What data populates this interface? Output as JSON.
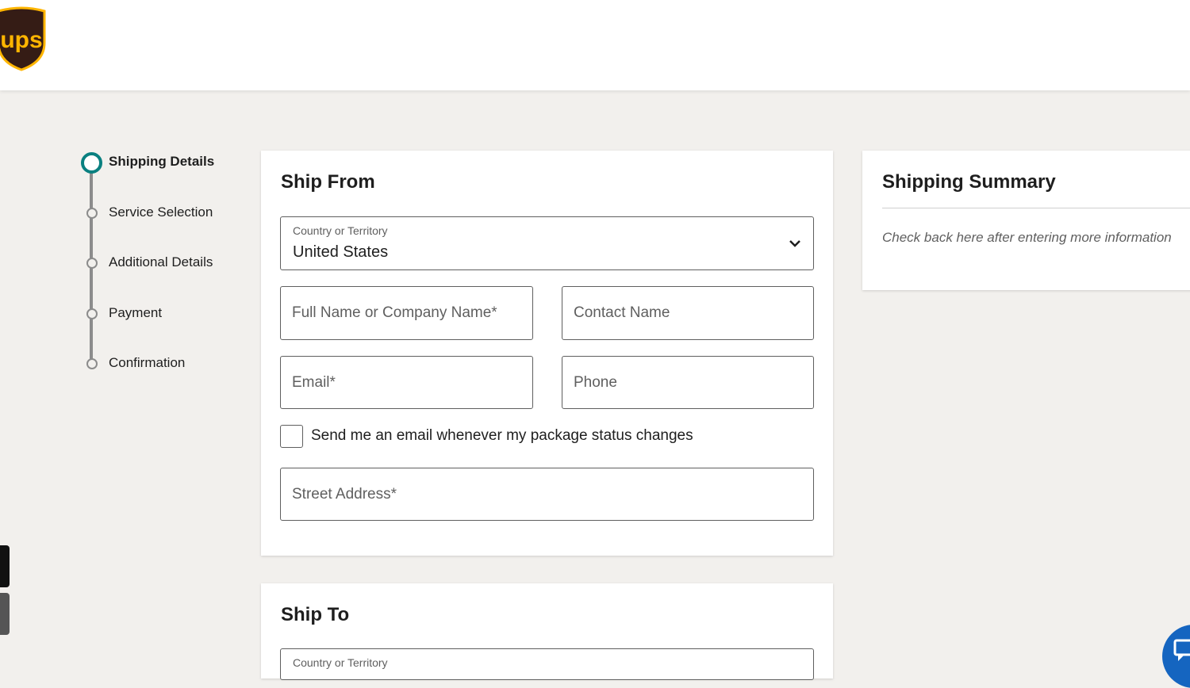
{
  "header": {
    "logo_text": "ups",
    "brand_colors": {
      "shield": "#351c15",
      "gold": "#ffb500"
    }
  },
  "stepper": {
    "accent_color": "#0a8080",
    "steps": [
      {
        "label": "Shipping Details",
        "active": true
      },
      {
        "label": "Service Selection",
        "active": false
      },
      {
        "label": "Additional Details",
        "active": false
      },
      {
        "label": "Payment",
        "active": false
      },
      {
        "label": "Confirmation",
        "active": false
      }
    ]
  },
  "ship_from": {
    "title": "Ship From",
    "country": {
      "label": "Country or Territory",
      "value": "United States",
      "icon": "chevron-down-icon"
    },
    "full_name": {
      "placeholder": "Full Name or Company Name*"
    },
    "contact_name": {
      "placeholder": "Contact Name"
    },
    "email": {
      "placeholder": "Email*"
    },
    "phone": {
      "placeholder": "Phone"
    },
    "notify_checkbox": {
      "label": "Send me an email whenever my package status changes",
      "checked": false
    },
    "street_address": {
      "placeholder": "Street Address*"
    }
  },
  "ship_to": {
    "title": "Ship To",
    "country": {
      "label": "Country or Territory"
    }
  },
  "summary": {
    "title": "Shipping Summary",
    "hint": "Check back here after entering more information"
  },
  "chat": {
    "icon": "chat-icon",
    "color": "#1565c0"
  }
}
